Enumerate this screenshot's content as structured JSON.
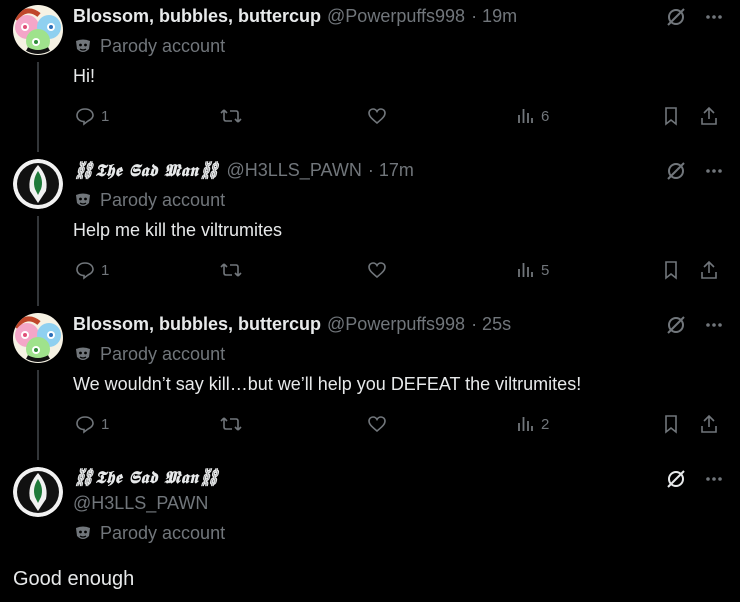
{
  "colors": {
    "background": "#000000",
    "text": "#e7e9ea",
    "muted": "#71767b",
    "thread_line": "#333639"
  },
  "posts": [
    {
      "name": "Blossom, bubbles, buttercup",
      "handle": "@Powerpuffs998",
      "time": "· 19m",
      "parody": "Parody account",
      "text": "Hi!",
      "replies": "1",
      "views": "6",
      "avatar": "powerpuff-avatar"
    },
    {
      "name": "⛓𝕿𝖍𝖊 𝕾𝖆𝖉 𝕸𝖆𝖓⛓",
      "handle": "@H3LLS_PAWN",
      "time": "· 17m",
      "parody": "Parody account",
      "text": "Help me kill the viltrumites",
      "replies": "1",
      "views": "5",
      "avatar": "spawn-avatar"
    },
    {
      "name": "Blossom, bubbles, buttercup",
      "handle": "@Powerpuffs998",
      "time": "· 25s",
      "parody": "Parody account",
      "text": "We wouldn’t say kill…but we’ll help you DEFEAT the viltrumites!",
      "replies": "1",
      "views": "2",
      "avatar": "powerpuff-avatar"
    }
  ],
  "main_post": {
    "name": "⛓𝕿𝖍𝖊 𝕾𝖆𝖉 𝕸𝖆𝖓⛓",
    "handle": "@H3LLS_PAWN",
    "parody": "Parody account",
    "text": "Good enough",
    "avatar": "spawn-avatar"
  }
}
